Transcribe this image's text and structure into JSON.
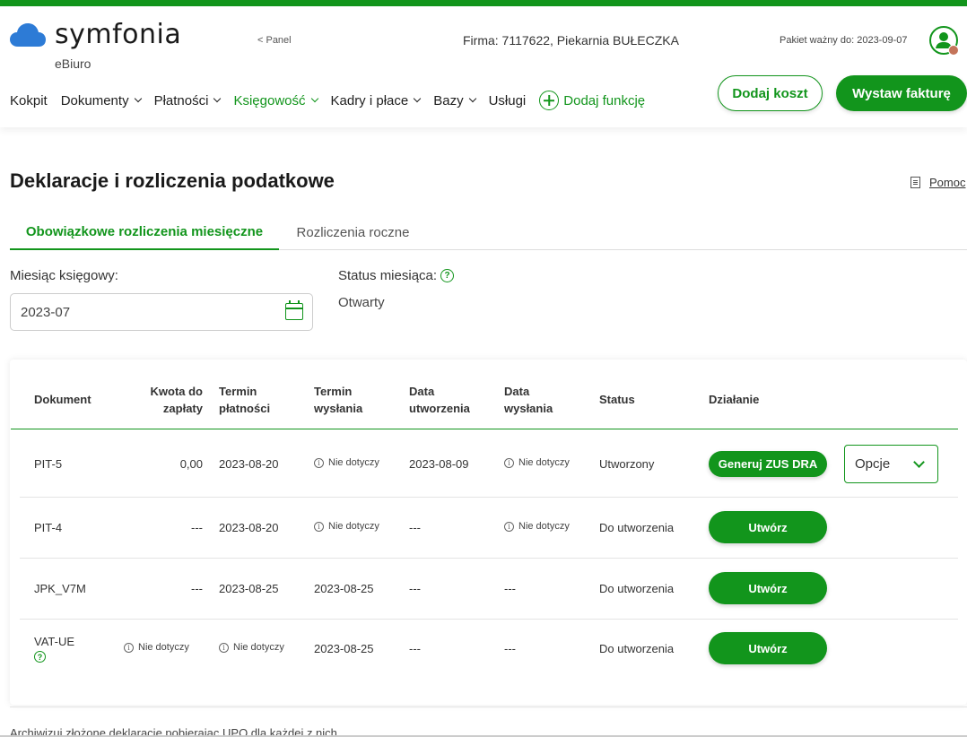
{
  "brand": {
    "name": "symfonia",
    "sub": "eBiuro",
    "accent": "#12951c"
  },
  "header": {
    "panel_link": "< Panel",
    "firma": "Firma:  7117622, Piekarnia BUŁECZKA",
    "pakiet": "Pakiet ważny do: 2023-09-07"
  },
  "nav": {
    "kokpit": "Kokpit",
    "dokumenty": "Dokumenty",
    "platnosci": "Płatności",
    "ksiegowosc": "Księgowość",
    "kadry": "Kadry i płace",
    "bazy": "Bazy",
    "uslugi": "Usługi",
    "dodaj_funkcje": "Dodaj funkcję"
  },
  "actions": {
    "dodaj_koszt": "Dodaj koszt",
    "wystaw_fakture": "Wystaw fakturę"
  },
  "page": {
    "title": "Deklaracje i rozliczenia podatkowe",
    "help": "Pomoc"
  },
  "tabs": [
    "Obowiązkowe rozliczenia miesięczne",
    "Rozliczenia roczne"
  ],
  "filters": {
    "month_label": "Miesiąc księgowy:",
    "month_value": "2023-07",
    "status_label": "Status miesiąca:",
    "status_value": "Otwarty"
  },
  "table": {
    "headers": {
      "dokument": "Dokument",
      "kwota_1": "Kwota do",
      "kwota_2": "zapłaty",
      "termin_p_1": "Termin",
      "termin_p_2": "płatności",
      "termin_w_1": "Termin",
      "termin_w_2": "wysłania",
      "data_u_1": "Data",
      "data_u_2": "utworzenia",
      "data_w_1": "Data",
      "data_w_2": "wysłania",
      "status": "Status",
      "dzialanie": "Działanie"
    },
    "na": "Nie dotyczy",
    "rows": [
      {
        "doc": "PIT-5",
        "kwota": "0,00",
        "termin_p": "2023-08-20",
        "data_u": "2023-08-09",
        "status": "Utworzony",
        "action": "Generuj ZUS DRA",
        "options": "Opcje"
      },
      {
        "doc": "PIT-4",
        "kwota": "---",
        "termin_p": "2023-08-20",
        "data_u": "---",
        "status": "Do utworzenia",
        "action": "Utwórz"
      },
      {
        "doc": "JPK_V7M",
        "kwota": "---",
        "termin_p": "2023-08-25",
        "termin_w": "2023-08-25",
        "data_u": "---",
        "data_w": "---",
        "status": "Do utworzenia",
        "action": "Utwórz"
      },
      {
        "doc": "VAT-UE",
        "termin_w": "2023-08-25",
        "data_u": "---",
        "data_w": "---",
        "status": "Do utworzenia",
        "action": "Utwórz"
      }
    ]
  },
  "footer": {
    "text": "Archiwizuj złożone deklaracje pobierając UPO dla każdej z nich."
  }
}
